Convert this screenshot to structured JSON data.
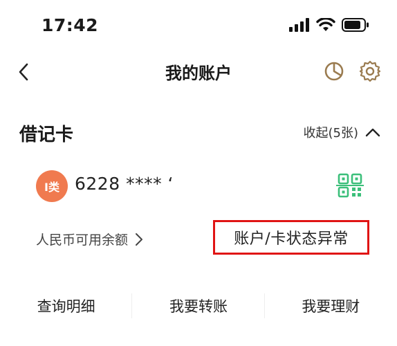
{
  "status_bar": {
    "time": "17:42"
  },
  "nav": {
    "title": "我的账户"
  },
  "section": {
    "title": "借记卡",
    "collapse_label": "收起(5张)"
  },
  "card": {
    "badge": "I类",
    "number": "6228 **** ‘"
  },
  "balance": {
    "label": "人民币可用余额"
  },
  "alert": {
    "text": "账户/卡状态异常"
  },
  "actions": [
    {
      "label": "查询明细"
    },
    {
      "label": "我要转账"
    },
    {
      "label": "我要理财"
    }
  ],
  "colors": {
    "accent_gold": "#9a7b4f",
    "badge_orange": "#f07a4f",
    "qr_green": "#3bbf7a",
    "alert_red": "#e01414"
  },
  "icons": {
    "back": "chevron-left-icon",
    "chart": "pie-chart-icon",
    "settings": "gear-icon",
    "collapse": "chevron-up-icon",
    "qr": "qr-code-icon",
    "balance_arrow": "chevron-right-icon"
  }
}
